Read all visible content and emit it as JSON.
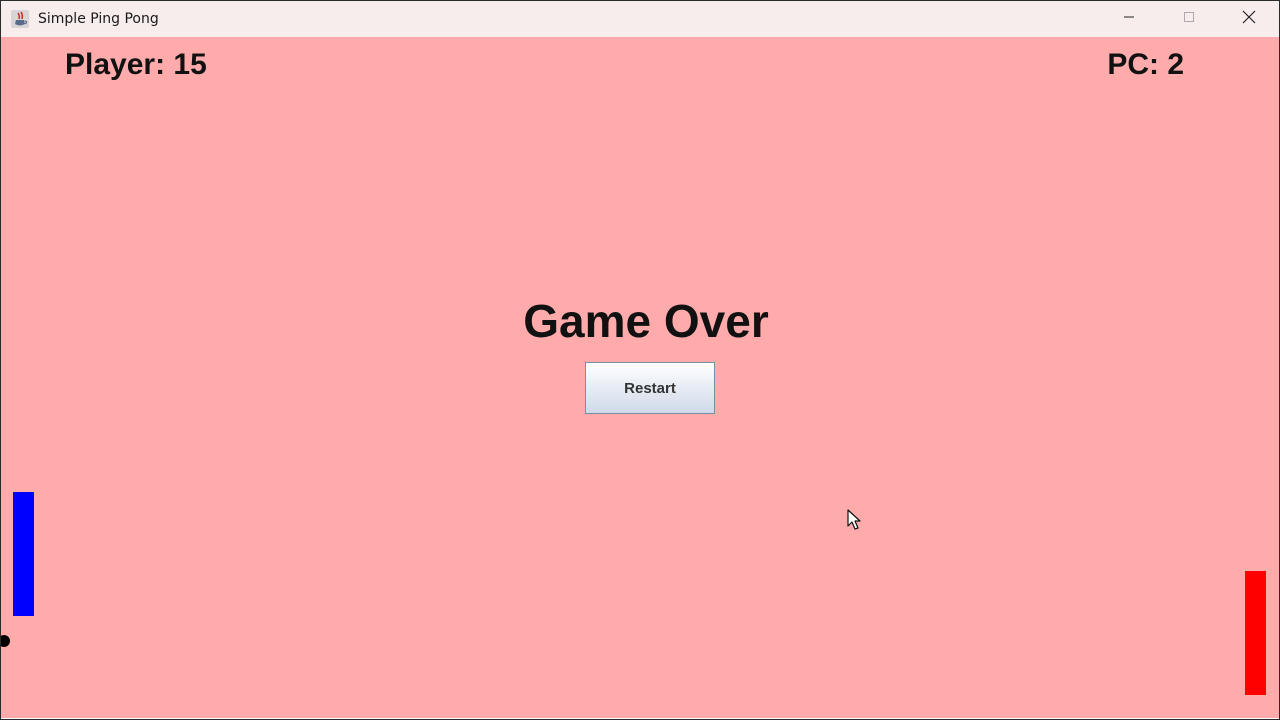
{
  "window": {
    "title": "Simple Ping Pong",
    "app_icon": "java-cup-icon",
    "controls": [
      "minimize-icon",
      "maximize-icon",
      "close-icon"
    ]
  },
  "game": {
    "background_color": "#ffabac",
    "player_score_text": "Player: 15",
    "pc_score_text": "PC: 2",
    "status_text": "Game Over",
    "restart_label": "Restart",
    "player_paddle_color": "#0000ff",
    "pc_paddle_color": "#ff0000",
    "ball_color": "#000000"
  }
}
